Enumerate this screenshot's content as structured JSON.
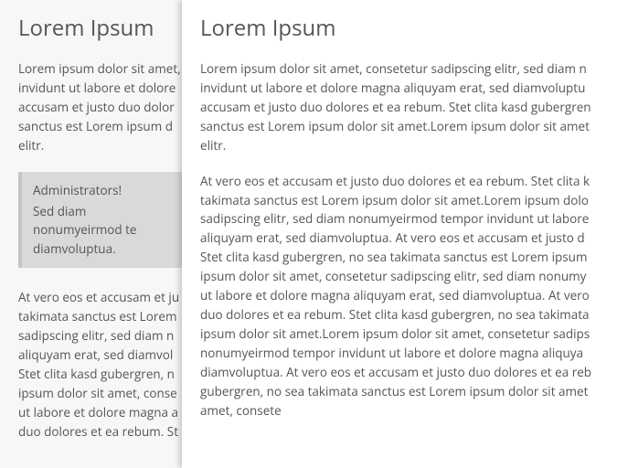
{
  "left": {
    "heading": "Lorem Ipsum",
    "para1": {
      "l1": "Lorem ipsum dolor sit amet,",
      "l2": "invidunt ut labore et dolore",
      "l3": "accusam et justo duo dolor",
      "l4": "sanctus est Lorem ipsum d",
      "l5": "elitr."
    },
    "notice": {
      "title": "Administrators!",
      "l1": "Sed diam nonumyeirmod te",
      "l2": "diamvoluptua."
    },
    "para2": {
      "l1": "At vero eos et accusam et ju",
      "l2": "takimata sanctus est Lorem",
      "l3": "sadipscing elitr, sed diam n",
      "l4": "aliquyam erat, sed diamvol",
      "l5": "Stet clita kasd gubergren, n",
      "l6": "ipsum dolor sit amet, conse",
      "l7": "ut labore et dolore magna a",
      "l8": "duo dolores et ea rebum. St"
    }
  },
  "right": {
    "heading": "Lorem Ipsum",
    "para1": {
      "l1": "Lorem ipsum dolor sit amet, consetetur sadipscing elitr, sed diam n",
      "l2": "invidunt ut labore et dolore magna aliquyam erat, sed diamvoluptu",
      "l3": "accusam et justo duo dolores et ea rebum. Stet clita kasd gubergren",
      "l4": "sanctus est Lorem ipsum dolor sit amet.Lorem ipsum dolor sit amet",
      "l5": "elitr."
    },
    "para2": {
      "l1": "At vero eos et accusam et justo duo dolores et ea rebum. Stet clita k",
      "l2": "takimata sanctus est Lorem ipsum dolor sit amet.Lorem ipsum dolo",
      "l3": "sadipscing elitr, sed diam nonumyeirmod tempor invidunt ut labore",
      "l4": "aliquyam erat, sed diamvoluptua. At vero eos et accusam et justo d",
      "l5": "Stet clita kasd gubergren, no sea takimata sanctus est Lorem ipsum",
      "l6": "ipsum dolor sit amet, consetetur sadipscing elitr, sed diam nonumy",
      "l7": "ut labore et dolore magna aliquyam erat, sed diamvoluptua. At vero",
      "l8": "duo dolores et ea rebum. Stet clita kasd gubergren, no sea takimata",
      "l9": "ipsum dolor sit amet.Lorem ipsum dolor sit amet, consetetur sadips",
      "l10": "nonumyeirmod tempor invidunt ut labore et dolore magna aliquya",
      "l11": "diamvoluptua. At vero eos et accusam et justo duo dolores et ea reb",
      "l12": "gubergren, no sea takimata sanctus est Lorem ipsum dolor sit amet",
      "l13": "amet, consete"
    }
  }
}
